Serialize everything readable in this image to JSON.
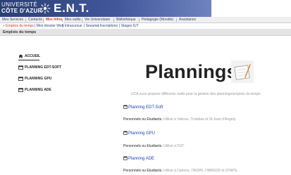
{
  "header": {
    "logo_line1": "UNIVERSITÉ",
    "logo_line2": "CÔTE D'AZUR",
    "app_title": "E.N.T."
  },
  "menu": {
    "items": [
      {
        "label": "Mes Services"
      },
      {
        "label": "Contacts"
      },
      {
        "label": "Mes Infos",
        "active": true
      },
      {
        "label": "Mes outils"
      },
      {
        "label": "Vie Universitaire"
      },
      {
        "label": "Bibliothèque"
      },
      {
        "label": "Pédagogie (Moodle)"
      },
      {
        "label": "Assistance"
      }
    ]
  },
  "submenu": {
    "items": [
      {
        "label": "» Emplois du temps",
        "active": true
      },
      {
        "label": "| Mon dossier Web"
      },
      {
        "label": "| Intracursus"
      },
      {
        "label": "| Sesame"
      },
      {
        "label": "| Inscriptions"
      },
      {
        "label": "| Stages IUT"
      }
    ]
  },
  "page_title": "Emplois du temps",
  "sidebar": {
    "items": [
      {
        "label": "ACCUEIL",
        "icon": "home-icon"
      },
      {
        "label": "PLANNING EDT-SOFT",
        "icon": "calendar-icon"
      },
      {
        "label": "PLANNING GPU",
        "icon": "calendar-icon"
      },
      {
        "label": "PLANNING ADE",
        "icon": "calendar-icon"
      }
    ]
  },
  "main": {
    "heading": "Plannings",
    "intro": "UCA vous propose différents outils pour la gestion des plannings/emplois du temps.",
    "plannings": [
      {
        "title": "Planning EDT-Soft",
        "who": "Personnels ou Etudiants.",
        "detail": " Utilisé à Valrose, Trotabas et St Jean d'Angely."
      },
      {
        "title": "Planning GPU",
        "who": "Personnels ou Etudiants.",
        "detail": " Utilisé à l'IUT."
      },
      {
        "title": "Planning ADE",
        "who": "Personnels ou Etudiants.",
        "detail": " Utilisé à Carlone, l'INSPE, l'IMREDD et STAPS."
      }
    ]
  },
  "colors": {
    "banner": "#41579a",
    "link": "#1a3fb8",
    "active_menu": "#c0392b"
  }
}
